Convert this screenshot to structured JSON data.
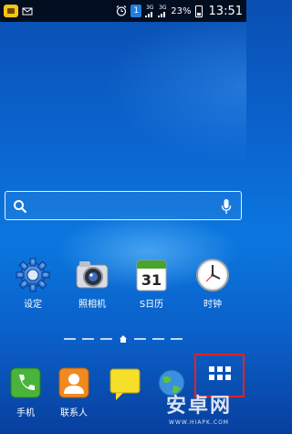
{
  "status_bar": {
    "time": "13:51",
    "battery_percent": "23%",
    "sim_badge": "1",
    "network_3g_a": "3G",
    "network_3g_b": "3G",
    "network_label": "3G"
  },
  "search": {
    "placeholder": ""
  },
  "apps": [
    {
      "label": "设定",
      "icon": "gear-icon"
    },
    {
      "label": "照相机",
      "icon": "camera-icon"
    },
    {
      "label": "S日历",
      "icon": "calendar-icon",
      "calendar_day": "31"
    },
    {
      "label": "时钟",
      "icon": "clock-icon"
    }
  ],
  "dock": [
    {
      "label": "手机",
      "icon": "phone-icon"
    },
    {
      "label": "联系人",
      "icon": "contacts-icon"
    },
    {
      "label": "",
      "icon": "messages-icon"
    },
    {
      "label": "",
      "icon": "browser-icon"
    },
    {
      "label": "",
      "icon": "apps-grid-icon"
    }
  ],
  "watermark": {
    "logo_text": "安卓网",
    "url": "WWW.HIAPK.COM"
  },
  "colors": {
    "highlight": "#e52222",
    "wallpaper": "#0b66d1"
  }
}
